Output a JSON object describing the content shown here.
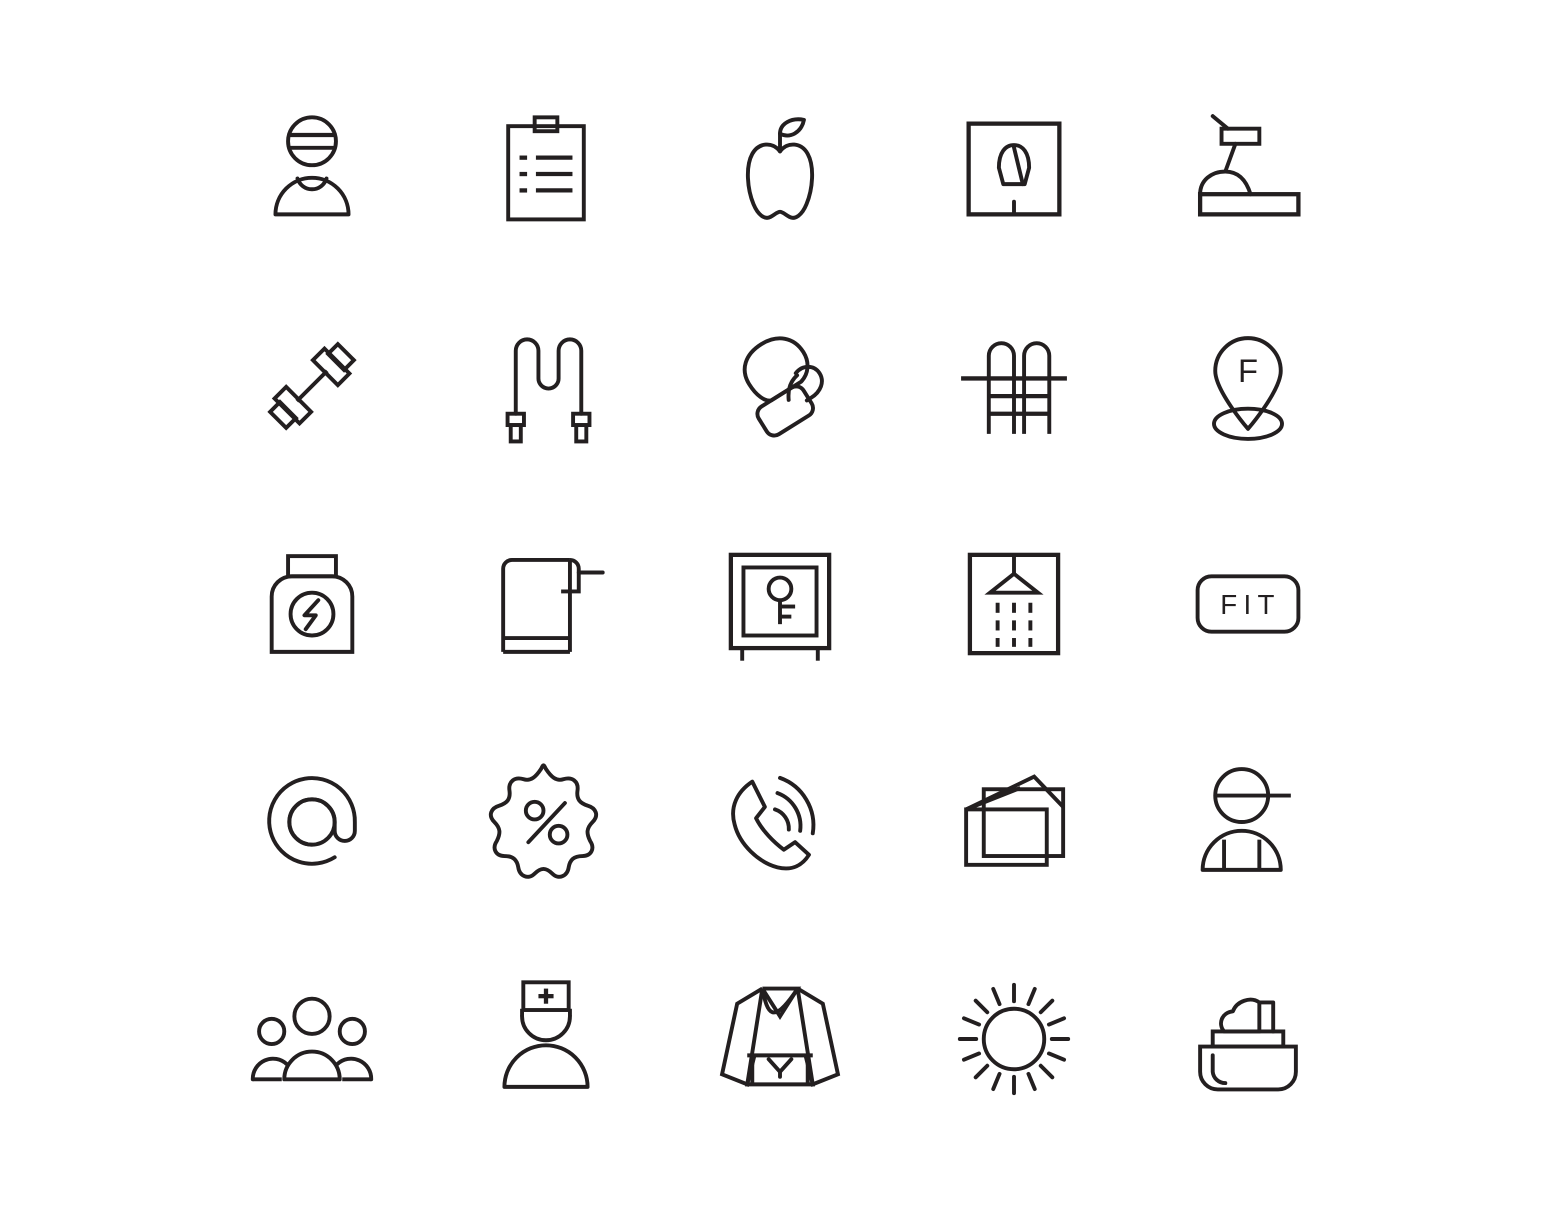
{
  "page": {
    "title": "Fitness & Gym Line Icon Set",
    "background_color": "#ffffff",
    "stroke_color": "#231f20",
    "columns": 5,
    "rows": 5,
    "icon_count": 25,
    "style": "outline / line icons"
  },
  "icons": [
    {
      "index": 1,
      "row": 1,
      "col": 1,
      "name": "athlete-headband-icon",
      "label": "Athlete with Headband"
    },
    {
      "index": 2,
      "row": 1,
      "col": 2,
      "name": "clipboard-checklist-icon",
      "label": "Training Plan Clipboard"
    },
    {
      "index": 3,
      "row": 1,
      "col": 3,
      "name": "apple-icon",
      "label": "Apple / Healthy Nutrition"
    },
    {
      "index": 4,
      "row": 1,
      "col": 4,
      "name": "bathroom-scale-icon",
      "label": "Weight Scale"
    },
    {
      "index": 5,
      "row": 1,
      "col": 5,
      "name": "treadmill-icon",
      "label": "Treadmill"
    },
    {
      "index": 6,
      "row": 2,
      "col": 1,
      "name": "dumbbell-icon",
      "label": "Dumbbell"
    },
    {
      "index": 7,
      "row": 2,
      "col": 2,
      "name": "jump-rope-icon",
      "label": "Jump Rope"
    },
    {
      "index": 8,
      "row": 2,
      "col": 3,
      "name": "boxing-glove-icon",
      "label": "Boxing Glove"
    },
    {
      "index": 9,
      "row": 2,
      "col": 4,
      "name": "pool-ladder-icon",
      "label": "Swimming Pool Ladder"
    },
    {
      "index": 10,
      "row": 2,
      "col": 5,
      "name": "fitness-location-pin-icon",
      "label": "Fitness Location Pin",
      "text": "F"
    },
    {
      "index": 11,
      "row": 3,
      "col": 1,
      "name": "supplement-jar-icon",
      "label": "Protein Supplement Jar"
    },
    {
      "index": 12,
      "row": 3,
      "col": 2,
      "name": "towel-rack-icon",
      "label": "Towel on Rack"
    },
    {
      "index": 13,
      "row": 3,
      "col": 3,
      "name": "locker-safe-key-icon",
      "label": "Locker / Safe with Key"
    },
    {
      "index": 14,
      "row": 3,
      "col": 4,
      "name": "shower-icon",
      "label": "Shower"
    },
    {
      "index": 15,
      "row": 3,
      "col": 5,
      "name": "fit-badge-icon",
      "label": "FIT Badge",
      "text": "FIT"
    },
    {
      "index": 16,
      "row": 4,
      "col": 1,
      "name": "email-at-icon",
      "label": "Email / At Sign"
    },
    {
      "index": 17,
      "row": 4,
      "col": 2,
      "name": "discount-percent-badge-icon",
      "label": "Discount Percent Badge"
    },
    {
      "index": 18,
      "row": 4,
      "col": 3,
      "name": "phone-ringing-icon",
      "label": "Ringing Phone"
    },
    {
      "index": 19,
      "row": 4,
      "col": 4,
      "name": "mail-envelope-stack-icon",
      "label": "Mail Envelope Stack"
    },
    {
      "index": 20,
      "row": 4,
      "col": 5,
      "name": "person-cap-icon",
      "label": "Person with Cap"
    },
    {
      "index": 21,
      "row": 5,
      "col": 1,
      "name": "group-people-icon",
      "label": "Group of People"
    },
    {
      "index": 22,
      "row": 5,
      "col": 2,
      "name": "medical-staff-icon",
      "label": "Medical Staff / Nurse"
    },
    {
      "index": 23,
      "row": 5,
      "col": 3,
      "name": "karate-gi-icon",
      "label": "Karate Gi / Kimono"
    },
    {
      "index": 24,
      "row": 5,
      "col": 4,
      "name": "sun-icon",
      "label": "Sun / Solarium",
      "rays": 16
    },
    {
      "index": 25,
      "row": 5,
      "col": 5,
      "name": "cosmetic-cream-jar-icon",
      "label": "Cosmetic Cream Jar"
    }
  ]
}
